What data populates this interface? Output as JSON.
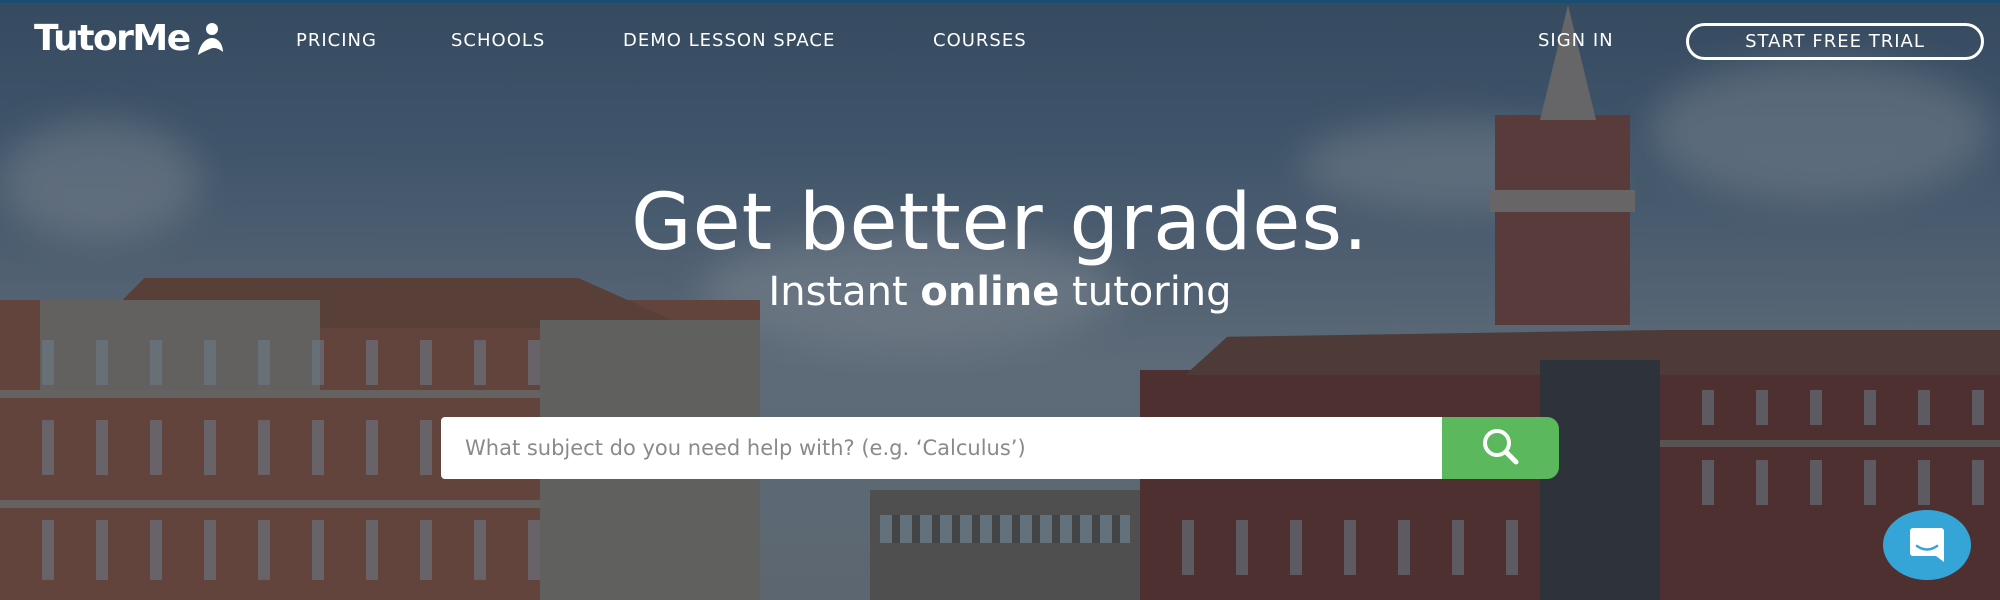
{
  "brand": {
    "name": "TutorMe",
    "logo_icon": "person-icon"
  },
  "nav": {
    "links": [
      {
        "label": "PRICING"
      },
      {
        "label": "SCHOOLS"
      },
      {
        "label": "DEMO LESSON SPACE"
      },
      {
        "label": "COURSES"
      }
    ],
    "sign_in": "SIGN IN",
    "cta": "START FREE TRIAL"
  },
  "hero": {
    "title": "Get better grades.",
    "subtitle_pre": "Instant ",
    "subtitle_bold": "online",
    "subtitle_post": " tutoring",
    "background": "university-campus-buildings-image"
  },
  "search": {
    "value": "",
    "placeholder": "What subject do you need help with? (e.g. ‘Calculus’)",
    "button_icon": "search-icon"
  },
  "chat": {
    "icon": "chat-bubble-icon"
  },
  "colors": {
    "accent_green": "#5cb85c",
    "chat_blue": "#34a5d6",
    "top_bar": "#1a4d72",
    "text": "#ffffff"
  }
}
